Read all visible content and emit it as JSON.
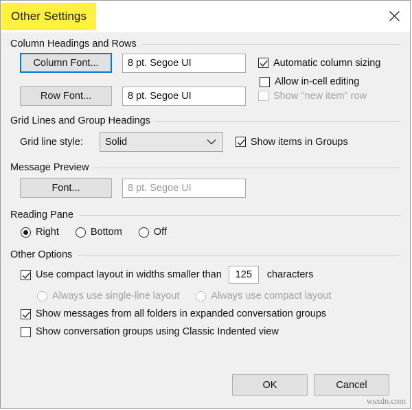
{
  "window": {
    "title": "Other Settings",
    "close_icon": "close-icon"
  },
  "sections": {
    "column_headings": {
      "heading": "Column Headings and Rows",
      "column_font_button": "Column Font...",
      "column_font_value": "8 pt. Segoe UI",
      "row_font_button": "Row Font...",
      "row_font_value": "8 pt. Segoe UI",
      "automatic_column_sizing": "Automatic column sizing",
      "allow_in_cell_editing": "Allow in-cell editing",
      "show_new_item_row": "Show \"new item\" row"
    },
    "grid_lines": {
      "heading": "Grid Lines and Group Headings",
      "grid_line_style_label": "Grid line style:",
      "grid_line_style_value": "Solid",
      "show_items_in_groups": "Show items in Groups"
    },
    "message_preview": {
      "heading": "Message Preview",
      "font_button": "Font...",
      "font_value": "8 pt. Segoe UI"
    },
    "reading_pane": {
      "heading": "Reading Pane",
      "option_right": "Right",
      "option_bottom": "Bottom",
      "option_off": "Off"
    },
    "other_options": {
      "heading": "Other Options",
      "compact_layout": "Use compact layout in widths smaller than",
      "compact_width_value": "125",
      "characters_label": "characters",
      "always_single_line": "Always use single-line layout",
      "always_compact": "Always use compact layout",
      "show_messages_all_folders": "Show messages from all folders in expanded conversation groups",
      "classic_indented_view": "Show conversation groups using Classic Indented view"
    }
  },
  "footer": {
    "ok": "OK",
    "cancel": "Cancel",
    "watermark": "wsxdn.com"
  },
  "colors": {
    "highlight": "#fff23f",
    "focus": "#0078d7",
    "dialog_bg": "#f0f0f0"
  }
}
